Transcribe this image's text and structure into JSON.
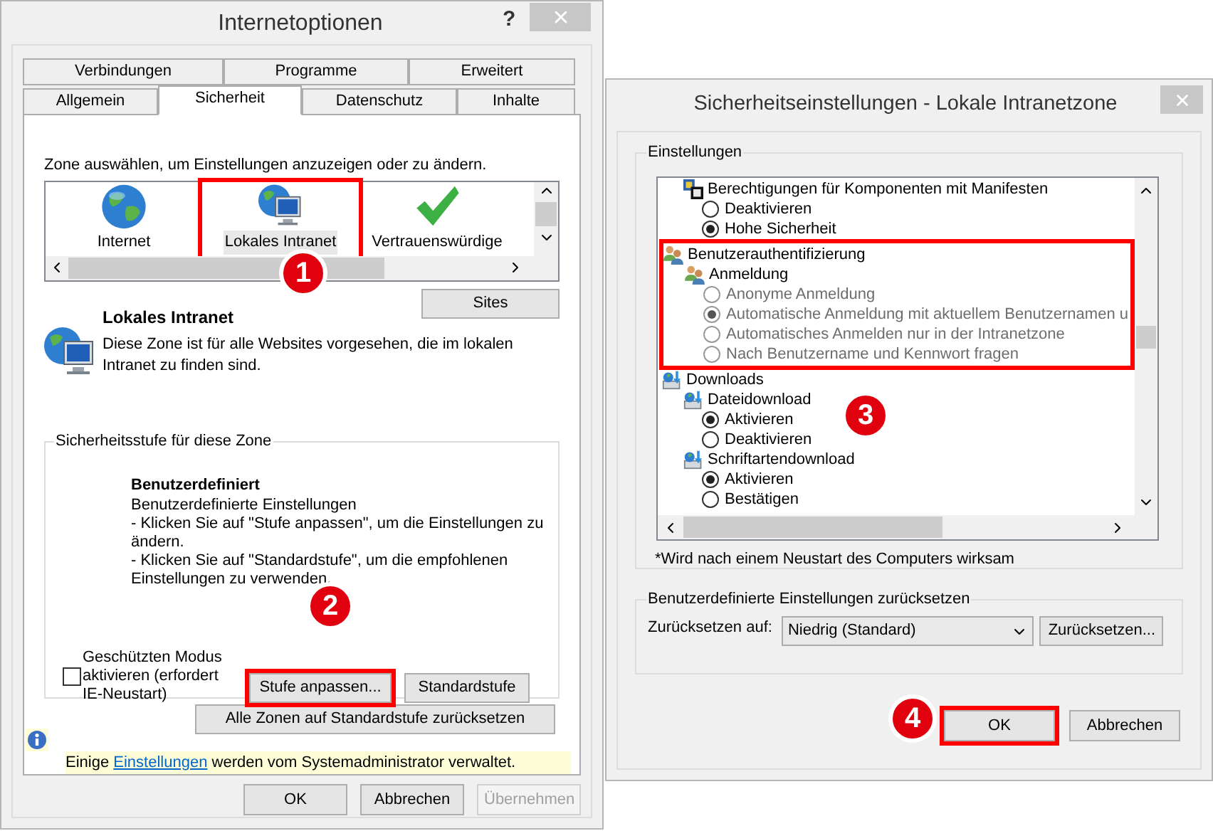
{
  "options_window": {
    "title": "Internetoptionen",
    "help": "?",
    "tabs_back": [
      {
        "label": "Verbindungen",
        "selected": false
      },
      {
        "label": "Programme",
        "selected": false
      },
      {
        "label": "Erweitert",
        "selected": false
      }
    ],
    "tabs_front": [
      {
        "label": "Allgemein",
        "selected": false
      },
      {
        "label": "Sicherheit",
        "selected": true
      },
      {
        "label": "Datenschutz",
        "selected": false
      },
      {
        "label": "Inhalte",
        "selected": false
      }
    ],
    "zone_prompt": "Zone auswählen, um Einstellungen anzuzeigen oder zu ändern.",
    "zones": [
      {
        "kind": "internet",
        "label": "Internet",
        "selected": false,
        "highlighted": false
      },
      {
        "kind": "intranet",
        "label": "Lokales Intranet",
        "selected": true,
        "highlighted": true
      },
      {
        "kind": "trusted",
        "label": "Vertrauenswürdige",
        "selected": false,
        "highlighted": false
      }
    ],
    "zone_info": {
      "title": "Lokales Intranet",
      "description": "Diese Zone ist für alle Websites vorgesehen, die im lokalen Intranet zu finden sind.",
      "button": "Sites"
    },
    "level_group": {
      "legend": "Sicherheitsstufe für diese Zone",
      "title": "Benutzerdefiniert",
      "lines": [
        "Benutzerdefinierte Einstellungen",
        "- Klicken Sie auf \"Stufe anpassen\", um die Einstellungen zu ändern.",
        "- Klicken Sie auf \"Standardstufe\", um die empfohlenen Einstellungen zu verwenden."
      ]
    },
    "protected_mode": {
      "label": "Geschützten Modus aktivieren (erfordert IE-Neustart)",
      "checked": false
    },
    "level_buttons": [
      {
        "label": "Stufe anpassen...",
        "highlighted": true
      },
      {
        "label": "Standardstufe",
        "highlighted": false
      }
    ],
    "reset_all": "Alle Zonen auf Standardstufe zurücksetzen",
    "notice": {
      "before": "Einige",
      "link": "Einstellungen",
      "after": "werden vom Systemadministrator verwaltet."
    },
    "buttons": [
      {
        "label": "OK",
        "disabled": false
      },
      {
        "label": "Abbrechen",
        "disabled": false
      },
      {
        "label": "Übernehmen",
        "disabled": true
      }
    ]
  },
  "settings_window": {
    "title": "Sicherheitseinstellungen - Lokale Intranetzone",
    "settings_legend": "Einstellungen",
    "tree": [
      {
        "kind": "manifest",
        "label": "Berechtigungen für Komponenten mit Manifesten",
        "highlighted": false,
        "children": [
          {
            "kind": "radio",
            "label": "Deaktivieren",
            "selected": false,
            "disabled": false
          },
          {
            "kind": "radio",
            "label": "Hohe Sicherheit",
            "selected": true,
            "disabled": false
          }
        ]
      },
      {
        "kind": "users",
        "label": "Benutzerauthentifizierung",
        "highlighted": true,
        "children": [
          {
            "kind": "users",
            "label": "Anmeldung",
            "highlighted": false,
            "children": [
              {
                "kind": "radio",
                "label": "Anonyme Anmeldung",
                "selected": false,
                "disabled": true
              },
              {
                "kind": "radio",
                "label": "Automatische Anmeldung mit aktuellem Benutzernamen u",
                "selected": true,
                "disabled": true
              },
              {
                "kind": "radio",
                "label": "Automatisches Anmelden nur in der Intranetzone",
                "selected": false,
                "disabled": true
              },
              {
                "kind": "radio",
                "label": "Nach Benutzername und Kennwort fragen",
                "selected": false,
                "disabled": true
              }
            ]
          }
        ]
      },
      {
        "kind": "download",
        "label": "Downloads",
        "highlighted": false,
        "children": [
          {
            "kind": "download",
            "label": "Dateidownload",
            "highlighted": false,
            "children": [
              {
                "kind": "radio",
                "label": "Aktivieren",
                "selected": true,
                "disabled": false
              },
              {
                "kind": "radio",
                "label": "Deaktivieren",
                "selected": false,
                "disabled": false
              }
            ]
          },
          {
            "kind": "download",
            "label": "Schriftartendownload",
            "highlighted": false,
            "children": [
              {
                "kind": "radio",
                "label": "Aktivieren",
                "selected": true,
                "disabled": false
              },
              {
                "kind": "radio",
                "label": "Bestätigen",
                "selected": false,
                "disabled": false
              }
            ]
          }
        ]
      }
    ],
    "footnote": "*Wird nach einem Neustart des Computers wirksam",
    "reset_group": {
      "legend": "Benutzerdefinierte Einstellungen zurücksetzen",
      "label": "Zurücksetzen auf:",
      "value": "Niedrig (Standard)",
      "button": "Zurücksetzen..."
    },
    "buttons": [
      {
        "label": "OK",
        "highlighted": true
      },
      {
        "label": "Abbrechen",
        "highlighted": false
      }
    ]
  },
  "annotation_markers": [
    {
      "number": "1"
    },
    {
      "number": "2"
    },
    {
      "number": "3"
    },
    {
      "number": "4"
    }
  ]
}
